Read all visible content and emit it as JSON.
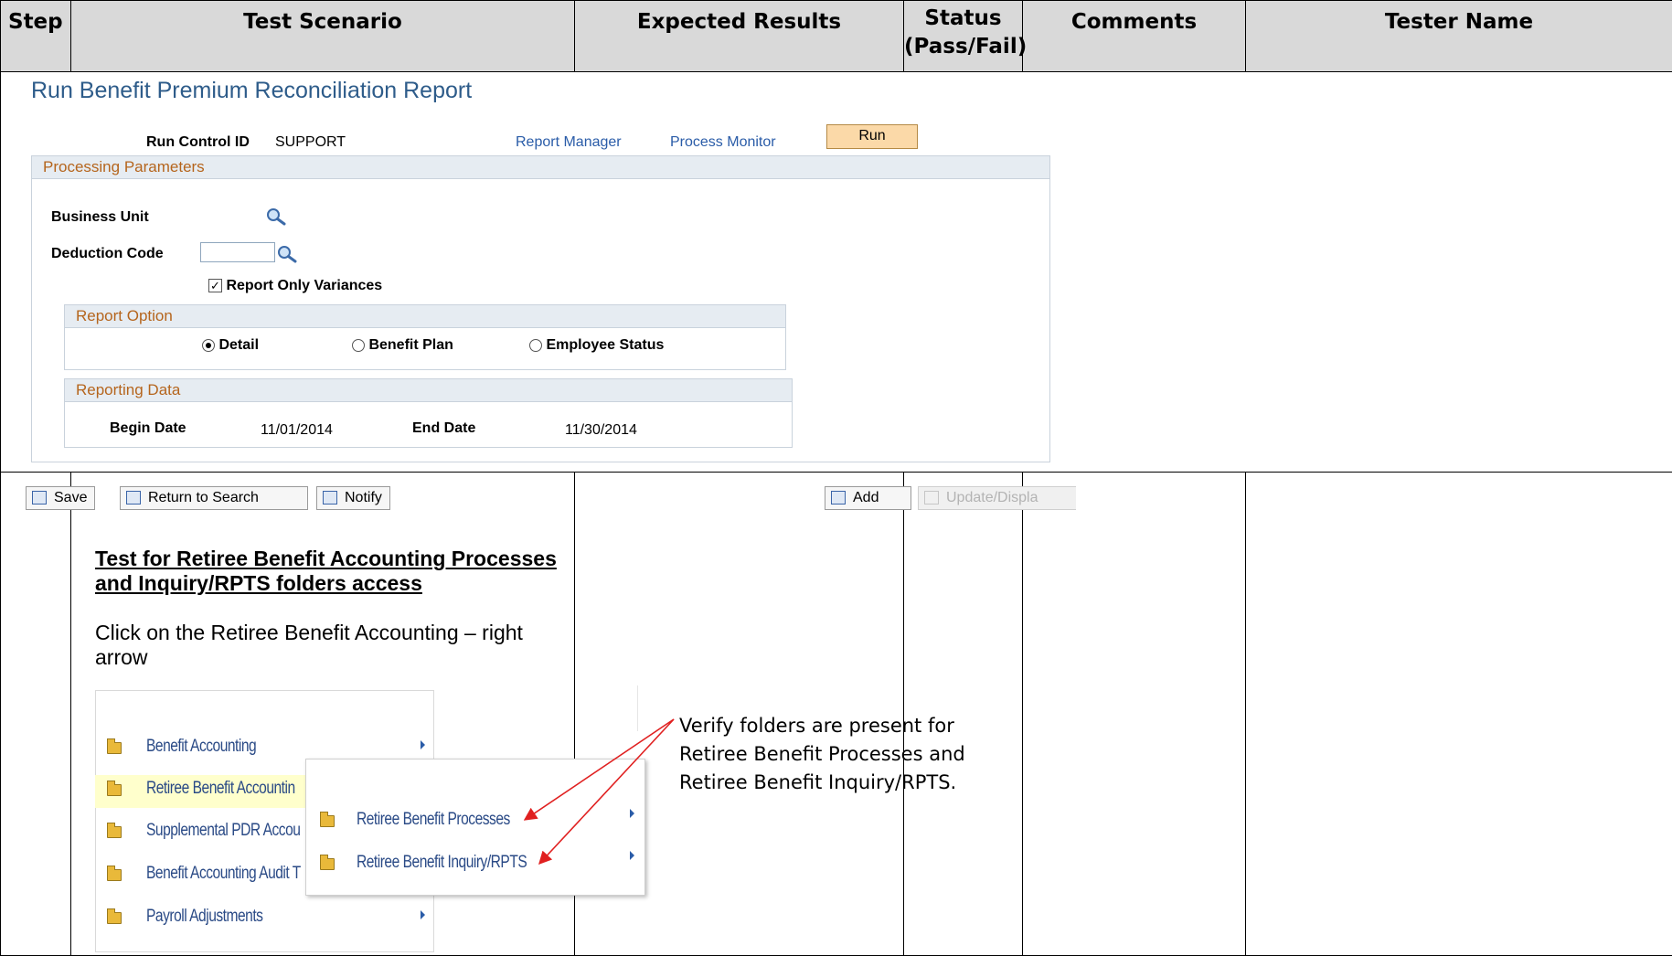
{
  "table": {
    "headers": {
      "step": "Step",
      "scenario": "Test Scenario",
      "expected": "Expected Results",
      "status_line1": "Status",
      "status_line2": "(Pass/Fail)",
      "comments": "Comments",
      "tester": "Tester Name"
    }
  },
  "run_control_screenshot": {
    "title": "Run Benefit Premium Reconciliation Report",
    "run_control_label": "Run Control ID",
    "run_control_value": "SUPPORT",
    "report_manager": "Report Manager",
    "process_monitor": "Process Monitor",
    "run_button": "Run",
    "processing_parameters": "Processing Parameters",
    "business_unit_label": "Business Unit",
    "deduction_code_label": "Deduction Code",
    "deduction_code_value": "",
    "report_only_variances": "Report Only Variances",
    "report_only_variances_checked": true,
    "report_option_header": "Report Option",
    "report_options": [
      "Detail",
      "Benefit Plan",
      "Employee Status"
    ],
    "report_option_selected": "Detail",
    "reporting_data_header": "Reporting Data",
    "begin_date_label": "Begin Date",
    "begin_date_value": "11/01/2014",
    "end_date_label": "End Date",
    "end_date_value": "11/30/2014",
    "toolbar": {
      "save": "Save",
      "return_to_search": "Return to Search",
      "notify": "Notify",
      "add": "Add",
      "update_display": "Update/Displa"
    }
  },
  "row2": {
    "scenario_title_line1": "Test for Retiree Benefit Accounting Processes",
    "scenario_title_line2": "and Inquiry/RPTS folders access",
    "instruction_line1": "Click on the Retiree Benefit Accounting – right",
    "instruction_line2": "arrow",
    "expected_line1": "Verify folders are present for",
    "expected_line2": "Retiree Benefit Processes and",
    "expected_line3": "Retiree Benefit Inquiry/RPTS."
  },
  "menu_screenshot": {
    "main_items": [
      "Benefit Accounting",
      "Retiree Benefit Accountin",
      "Supplemental PDR Accou",
      "Benefit Accounting Audit T",
      "Payroll Adjustments"
    ],
    "submenu_items": [
      "Retiree Benefit Processes",
      "Retiree Benefit Inquiry/RPTS"
    ],
    "highlight_color": "#ffffcc",
    "annotation_arrow_color": "#e02020"
  }
}
